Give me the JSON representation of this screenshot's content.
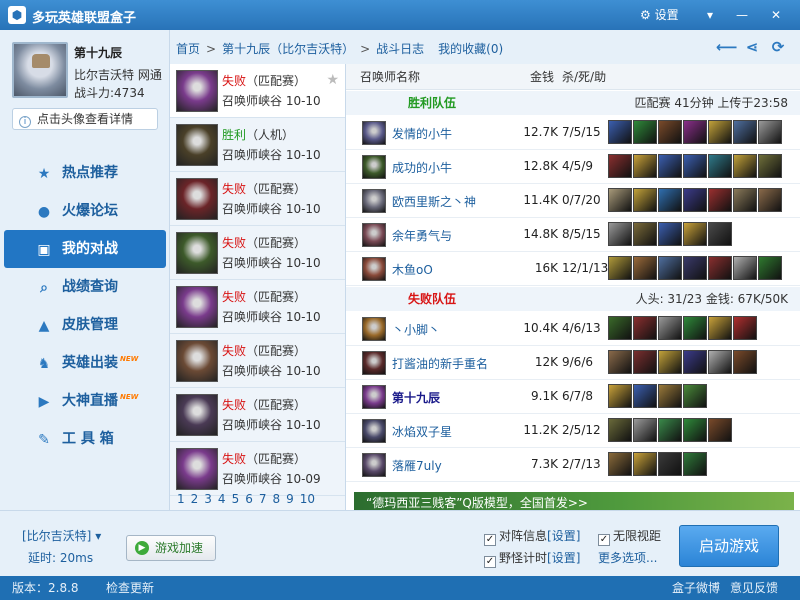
{
  "window": {
    "title": "多玩英雄联盟盒子",
    "settings_label": "设置"
  },
  "profile": {
    "name": "第十九辰",
    "server": "比尔吉沃特 网通",
    "power": "战斗力:4734",
    "hint": "点击头像查看详情"
  },
  "nav": [
    {
      "label": "热点推荐",
      "icon": "star-icon",
      "new": false
    },
    {
      "label": "火爆论坛",
      "icon": "chat-icon",
      "new": false
    },
    {
      "label": "我的对战",
      "icon": "battle-icon",
      "new": false,
      "active": true
    },
    {
      "label": "战绩查询",
      "icon": "search-icon",
      "new": false
    },
    {
      "label": "皮肤管理",
      "icon": "hat-icon",
      "new": false
    },
    {
      "label": "英雄出装",
      "icon": "hero-icon",
      "new": true
    },
    {
      "label": "大神直播",
      "icon": "play-icon",
      "new": true
    },
    {
      "label": "工 具 箱",
      "icon": "wrench-icon",
      "new": false
    }
  ],
  "new_badge": "NEW",
  "breadcrumb": {
    "home": "首页",
    "player": "第十九辰（比尔吉沃特）",
    "log": "战斗日志",
    "favorites": "我的收藏(0)"
  },
  "matches": [
    {
      "result": "失败",
      "outcome": "lose",
      "mode": "（匹配赛）",
      "map": "召唤师峡谷 10-10",
      "color": "#7a3b8c"
    },
    {
      "result": "胜利",
      "outcome": "win",
      "mode": "（人机）",
      "map": "召唤师峡谷 10-10",
      "color": "#4a4028"
    },
    {
      "result": "失败",
      "outcome": "lose",
      "mode": "（匹配赛）",
      "map": "召唤师峡谷 10-10",
      "color": "#6b2428"
    },
    {
      "result": "失败",
      "outcome": "lose",
      "mode": "（匹配赛）",
      "map": "召唤师峡谷 10-10",
      "color": "#3d5a2a"
    },
    {
      "result": "失败",
      "outcome": "lose",
      "mode": "（匹配赛）",
      "map": "召唤师峡谷 10-10",
      "color": "#7a3b8c"
    },
    {
      "result": "失败",
      "outcome": "lose",
      "mode": "（匹配赛）",
      "map": "召唤师峡谷 10-10",
      "color": "#6b4a35"
    },
    {
      "result": "失败",
      "outcome": "lose",
      "mode": "（匹配赛）",
      "map": "召唤师峡谷 10-10",
      "color": "#4a3a55"
    },
    {
      "result": "失败",
      "outcome": "lose",
      "mode": "（匹配赛）",
      "map": "召唤师峡谷 10-09",
      "color": "#7a3b8c"
    }
  ],
  "pages": [
    "1",
    "2",
    "3",
    "4",
    "5",
    "6",
    "7",
    "8",
    "9",
    "10"
  ],
  "detail": {
    "headers": {
      "name": "召唤师名称",
      "gold": "金钱",
      "kda": "杀/死/助"
    },
    "win_team": {
      "label": "胜利队伍",
      "info": "匹配赛 41分钟 上传于23:58",
      "color": "#229a22"
    },
    "lose_team": {
      "label": "失败队伍",
      "info": "人头: 31/23 金钱: 67K/50K",
      "color": "#d81414"
    },
    "win_players": [
      {
        "name": "发情的小牛",
        "gold": "12.7K",
        "kda": "7/5/15",
        "hero_color": "#5a5a8a",
        "items": [
          "#3b5fb0",
          "#2f8a3a",
          "#7a4a2a",
          "#8a2f8a",
          "#c2a23a",
          "#4f6f9f",
          "#9a9a9a"
        ]
      },
      {
        "name": "成功的小牛",
        "gold": "12.8K",
        "kda": "4/5/9",
        "hero_color": "#3d5a2a",
        "items": [
          "#8a2f2f",
          "#c9a23a",
          "#3b5fb0",
          "#3b5fb0",
          "#2f7a8a",
          "#c2a23a",
          "#6f6f3a"
        ]
      },
      {
        "name": "欧西里斯之丶神",
        "gold": "11.4K",
        "kda": "0/7/20",
        "hero_color": "#6a6a7a",
        "items": [
          "#a89a7a",
          "#c2a23a",
          "#2f6fb0",
          "#3b3b8a",
          "#9a2f2f",
          "#8a7a5a",
          "#8a6a4a"
        ]
      },
      {
        "name": "余年勇气与",
        "gold": "14.8K",
        "kda": "8/5/15",
        "hero_color": "#7a4a55",
        "items": [
          "#9a9a9a",
          "#7a6a3a",
          "#3b5fb0",
          "#c9a23a",
          "#4a4a4a"
        ]
      },
      {
        "name": "木鱼oO",
        "gold": "16K",
        "kda": "12/1/13",
        "hero_color": "#8a4a3a",
        "items": [
          "#b09a3a",
          "#9a6a3a",
          "#4f6f9f",
          "#3a3a6a",
          "#8a2f2f",
          "#b0b0b0",
          "#2f7a2f"
        ]
      }
    ],
    "lose_players": [
      {
        "name": "丶小脚丶",
        "gold": "10.4K",
        "kda": "4/6/13",
        "hero_color": "#9a6a2a",
        "items": [
          "#3a6a2a",
          "#8a2f2f",
          "#9a9a9a",
          "#2f8a3a",
          "#c9a23a",
          "#b02f2f"
        ]
      },
      {
        "name": "打酱油的新手重名",
        "gold": "12K",
        "kda": "9/6/6",
        "hero_color": "#5a2a2a",
        "items": [
          "#8a6a4a",
          "#7a2f2f",
          "#c2a23a",
          "#3b3b8a",
          "#b0b0b0",
          "#7a4a2a"
        ]
      },
      {
        "name": "第十九辰",
        "gold": "9.1K",
        "kda": "6/7/8",
        "hero_color": "#7a3b8c",
        "bold": true,
        "items": [
          "#c9a23a",
          "#3b5fb0",
          "#9a7a3a",
          "#4a8a3a"
        ]
      },
      {
        "name": "冰焰双子星",
        "gold": "11.2K",
        "kda": "2/5/12",
        "hero_color": "#4a4a6a",
        "items": [
          "#6a6a3a",
          "#9a9a9a",
          "#3a8a4a",
          "#2f8a3a",
          "#7a4a2a"
        ]
      },
      {
        "name": "落雁7uly",
        "gold": "7.3K",
        "kda": "2/7/13",
        "hero_color": "#5a4a6a",
        "items": [
          "#8a6a3a",
          "#c9a23a",
          "#3a3a3a",
          "#2f7a3a"
        ]
      }
    ],
    "banner": "“德玛西亚三贱客”Q版模型，全国首发>>"
  },
  "bottom": {
    "server": "[比尔吉沃特]",
    "ping": "延时: 20ms",
    "accel": "游戏加速",
    "opt1": "对阵信息",
    "opt1_link": "[设置]",
    "opt2": "无限视距",
    "opt3": "野怪计时",
    "opt3_link": "[设置]",
    "more": "更多选项...",
    "start": "启动游戏"
  },
  "status": {
    "version": "版本：2.8.8",
    "update": "检查更新",
    "weibo": "盒子微博",
    "feedback": "意见反馈"
  }
}
